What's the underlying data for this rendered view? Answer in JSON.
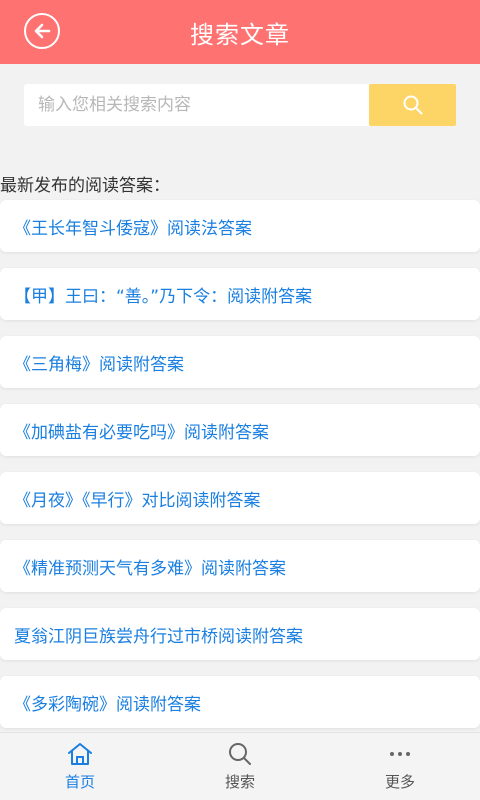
{
  "header": {
    "title": "搜索文章"
  },
  "search": {
    "placeholder": "输入您相关搜索内容"
  },
  "section_title": "最新发布的阅读答案：",
  "articles": [
    "《王长年智斗倭寇》阅读法答案",
    "【甲】王曰：“善。”乃下令：阅读附答案",
    "《三角梅》阅读附答案",
    "《加碘盐有必要吃吗》阅读附答案",
    "《月夜》《早行》对比阅读附答案",
    "《精准预测天气有多难》阅读附答案",
    "夏翁江阴巨族尝舟行过市桥阅读附答案",
    "《多彩陶碗》阅读附答案"
  ],
  "nav": {
    "home": "首页",
    "search": "搜索",
    "more": "更多"
  },
  "colors": {
    "header": "#fe7272",
    "search_button": "#fcd566",
    "link": "#1a7fe0"
  },
  "icons": {
    "back": "back-arrow-circle-icon",
    "search": "search-icon",
    "home": "home-icon",
    "more": "more-dots-icon"
  }
}
